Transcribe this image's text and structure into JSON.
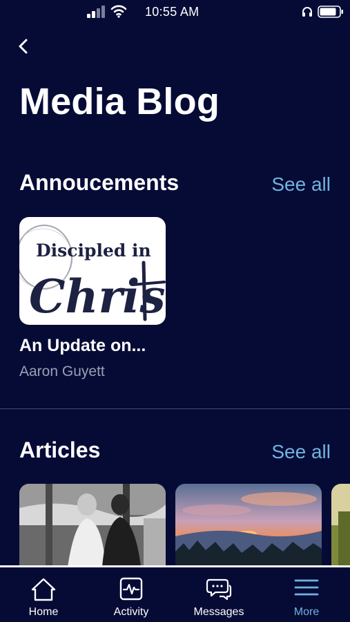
{
  "status_bar": {
    "time": "10:55 AM"
  },
  "header": {
    "title": "Media Blog"
  },
  "announcements": {
    "title": "Annoucements",
    "see_all": "See all",
    "items": [
      {
        "image_text_top": "Discipled in",
        "image_text_bottom": "Christ",
        "title": "An Update on...",
        "author": "Aaron Guyett"
      }
    ]
  },
  "articles": {
    "title": "Articles",
    "see_all": "See all"
  },
  "tab_bar": {
    "items": [
      {
        "label": "Home",
        "icon": "home-icon"
      },
      {
        "label": "Activity",
        "icon": "activity-icon"
      },
      {
        "label": "Messages",
        "icon": "messages-icon"
      },
      {
        "label": "More",
        "icon": "menu-icon",
        "active": true
      }
    ]
  },
  "colors": {
    "background": "#060b36",
    "accent": "#6fb4df"
  }
}
